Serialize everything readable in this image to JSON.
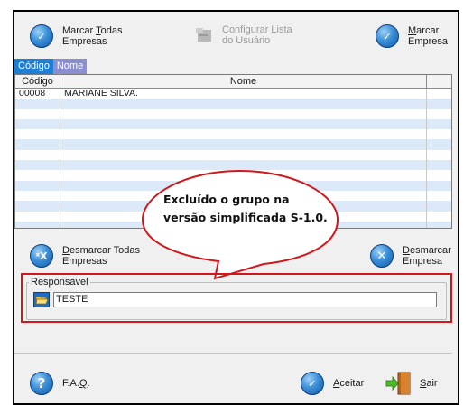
{
  "toolbar": {
    "mark_all": {
      "line1_pre": "Marcar ",
      "line1_key": "T",
      "line1_post": "odas",
      "line2": "Empresas"
    },
    "config_list": {
      "line1": "Configurar Lista",
      "line2": "do Usuário"
    },
    "mark": {
      "line1_key": "M",
      "line1_post": "arcar",
      "line2": "Empresa"
    }
  },
  "tabs": [
    {
      "label": "Código"
    },
    {
      "label": "Nome"
    }
  ],
  "grid": {
    "columns": [
      "Código",
      "Nome"
    ],
    "rows": [
      {
        "codigo": "00008",
        "nome": "MARIANE SILVA."
      }
    ],
    "empty_rows": 13
  },
  "callout": {
    "line1": "Excluído o grupo na",
    "line2": "versão simplificada S-1.0."
  },
  "actions": {
    "unmark_all": {
      "line1_key": "D",
      "line1_post": "esmarcar Todas",
      "line2": "Empresas"
    },
    "unmark": {
      "line1_key": "D",
      "line1_post": "esmarcar",
      "line2": "Empresa"
    }
  },
  "responsavel": {
    "label": "Responsável",
    "value": "TESTE"
  },
  "footer": {
    "faq": {
      "pre": "F.A.",
      "key": "Q",
      "post": "."
    },
    "accept": {
      "key": "A",
      "post": "ceitar"
    },
    "exit": {
      "key": "S",
      "post": "air"
    }
  },
  "colors": {
    "highlight_border": "#d0181c",
    "row_alt": "#dbe9f8",
    "tab_active": "#1e7fd6",
    "tab_inactive": "#8b8fd0"
  }
}
